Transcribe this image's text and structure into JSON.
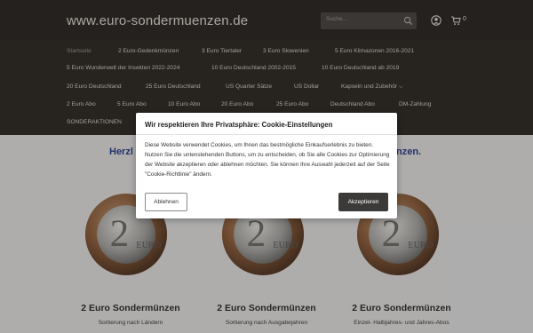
{
  "header": {
    "logo": "www.euro-sondermuenzen.de",
    "search_placeholder": "Suche...",
    "cart_count": "0",
    "icons": [
      "search-icon",
      "user-icon",
      "cart-icon"
    ]
  },
  "nav": {
    "items": [
      {
        "label": "Startseite",
        "active": true
      },
      {
        "label": "2 Euro-Gedenkmünzen"
      },
      {
        "label": "3 Euro Tiertaler"
      },
      {
        "label": "3 Euro Slowenien"
      },
      {
        "label": "5 Euro Klimazonen 2016-2021"
      },
      {
        "label": "5 Euro Wunderwelt der Insekten 2022-2024"
      },
      {
        "label": "10 Euro Deutschland 2002-2015"
      },
      {
        "label": "10 Euro Deutschland ab 2019"
      },
      {
        "label": "20 Euro Deutschland"
      },
      {
        "label": "25 Euro Deutschland"
      },
      {
        "label": "US Quarter Sätze"
      },
      {
        "label": "US Dollar"
      },
      {
        "label": "Kapseln und Zubehör"
      },
      {
        "label": "2 Euro Abo"
      },
      {
        "label": "5 Euro Abo"
      },
      {
        "label": "10 Euro Abo"
      },
      {
        "label": "20 Euro Abo"
      },
      {
        "label": "25 Euro Abo"
      },
      {
        "label": "Deutschland Abo"
      },
      {
        "label": "DM-Zahlung"
      },
      {
        "label": "SONDERAKTIONEN"
      }
    ]
  },
  "main": {
    "headline_left": "Herzl",
    "headline_right": "nzen.",
    "columns": [
      {
        "title": "2 Euro Sondermünzen",
        "subtitle": "Sortierung nach Ländern"
      },
      {
        "title": "2 Euro Sondermünzen",
        "subtitle": "Sortierung nach Ausgabejahren"
      },
      {
        "title": "2 Euro Sondermünzen",
        "subtitle": "Einzel- Halbjahres- und Jahres-Abos"
      }
    ],
    "coin_text": "EURO"
  },
  "cookie": {
    "title": "Wir respektieren Ihre Privatsphäre: Cookie-Einstellungen",
    "text": "Diese Website verwendet Cookies, um Ihnen das bestmögliche Einkaufserlebnis zu bieten. Nutzen Sie die untenstehenden Buttons, um zu entscheiden, ob Sie alle Cookies zur Optimierung der Website akzeptieren oder ablehnen möchten. Sie können Ihre Auswahl jederzeit auf der Seite \"Cookie-Richtlinie\" ändern.",
    "decline_label": "Ablehnen",
    "accept_label": "Akzeptieren"
  },
  "colors": {
    "topbar": "#2b2724",
    "nav": "#2f2b28",
    "headline": "#2a3d8f",
    "accept_button": "#3c3a39"
  }
}
